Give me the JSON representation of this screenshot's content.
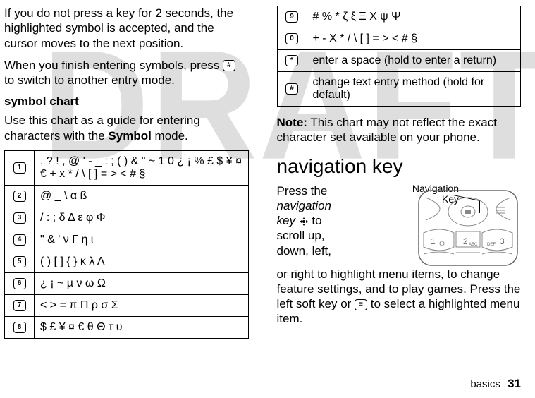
{
  "watermark": "DRAFT",
  "left": {
    "p1": "If you do not press a key for 2 seconds, the highlighted symbol is accepted, and the cursor moves to the next position.",
    "p2a": "When you finish entering symbols, press ",
    "p2_key": "#",
    "p2b": " to switch to another entry mode.",
    "h2": "symbol chart",
    "p3a": "Use this chart as a guide for entering characters with the ",
    "p3_bold": "Symbol",
    "p3b": " mode.",
    "rows": [
      {
        "key": "1",
        "val": ". ? ! , @ ' - _ : ; ( ) & \" ~ 1 0 ¿ ¡ % £ $ ¥ ¤ € + x * / \\ [ ] = > < # §"
      },
      {
        "key": "2",
        "val": "@ _ \\  α  ß"
      },
      {
        "key": "3",
        "val": "/ : ; δ Δ ε φ Φ"
      },
      {
        "key": "4",
        "val": "\" & ' ν Γ η ι"
      },
      {
        "key": "5",
        "val": "( ) [ ] { } κ λ Λ"
      },
      {
        "key": "6",
        "val": "¿ ¡ ~ µ ν ω Ω"
      },
      {
        "key": "7",
        "val": "< > = π Π ρ σ Σ"
      },
      {
        "key": "8",
        "val": "$ £ ¥ ¤ € θ Θ τ υ"
      }
    ]
  },
  "right": {
    "rows": [
      {
        "key": "9",
        "val": "# %  * ζ ξ Ξ Χ ψ Ψ"
      },
      {
        "key": "0",
        "val": "+ - Χ * / \\ [ ] = > < # §"
      },
      {
        "key": "*",
        "val": "enter a space (hold to enter a return)"
      },
      {
        "key": "#",
        "val": "change text entry method (hold for default)"
      }
    ],
    "note_bold": "Note:",
    "note_text": " This chart may not reflect the exact character set available on your phone.",
    "h1": "navigation key",
    "nav_a": "Press the ",
    "nav_i": "navigation key",
    "nav_b": " ",
    "nav_c": " to scroll up, down, left, or right to highlight menu items, to change feature settings, and to play games. Press the left soft key or ",
    "nav_key": "≡",
    "nav_d": " to select a highlighted menu item.",
    "navlabel1": "Navigation",
    "navlabel2": "Key"
  },
  "footer": {
    "section": "basics",
    "page": "31"
  }
}
